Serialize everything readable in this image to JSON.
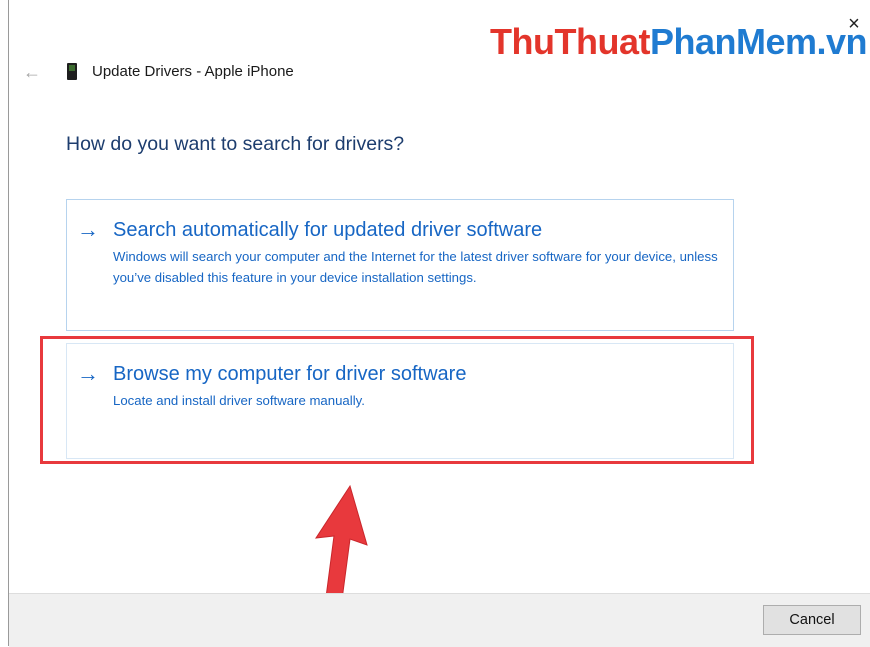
{
  "window": {
    "title": "Update Drivers - Apple iPhone",
    "close_glyph": "×",
    "back_glyph": "←"
  },
  "watermark": {
    "part1": "ThuThuat",
    "part2": "PhanMem.vn"
  },
  "question": "How do you want to search for drivers?",
  "options": [
    {
      "arrow": "→",
      "title": "Search automatically for updated driver software",
      "description": "Windows will search your computer and the Internet for the latest driver software for your device, unless you’ve disabled this feature in your device installation settings."
    },
    {
      "arrow": "→",
      "title": "Browse my computer for driver software",
      "description": "Locate and install driver software manually."
    }
  ],
  "footer": {
    "cancel_label": "Cancel"
  },
  "colors": {
    "link_blue": "#1766c4",
    "highlight_red": "#e8393d",
    "watermark_red": "#e3352b",
    "watermark_blue": "#1f7bd1"
  },
  "icons": {
    "device": "phone-icon",
    "back": "back-arrow-icon",
    "close": "close-icon",
    "option_arrow": "right-arrow-icon",
    "pointer": "red-pointer-arrow-icon"
  }
}
